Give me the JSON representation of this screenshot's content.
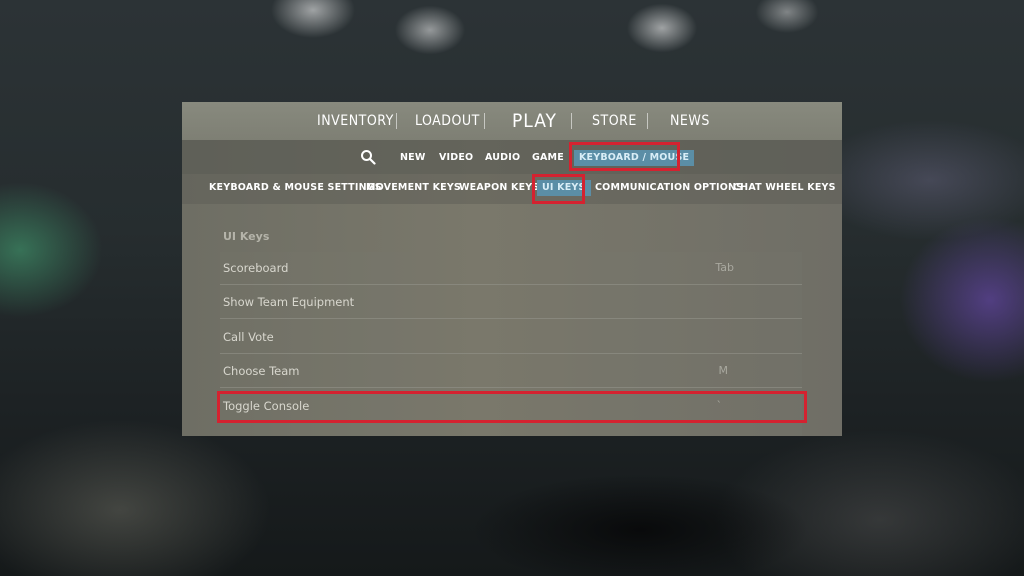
{
  "topnav": {
    "inventory": "INVENTORY",
    "loadout": "LOADOUT",
    "play": "PLAY",
    "store": "STORE",
    "news": "NEWS"
  },
  "settings_tabs": {
    "new": "NEW",
    "video": "VIDEO",
    "audio": "AUDIO",
    "game": "GAME",
    "keyboard_mouse": "KEYBOARD / MOUSE"
  },
  "categories": {
    "keyboard_mouse_settings": "KEYBOARD & MOUSE SETTINGS",
    "movement_keys": "MOVEMENT KEYS",
    "weapon_keys": "WEAPON KEYS",
    "ui_keys": "UI KEYS",
    "communication_options": "COMMUNICATION OPTIONS",
    "chat_wheel_keys": "CHAT WHEEL KEYS"
  },
  "section": {
    "title": "UI Keys",
    "rows": [
      {
        "label": "Scoreboard",
        "key": "Tab"
      },
      {
        "label": "Show Team Equipment",
        "key": ""
      },
      {
        "label": "Call Vote",
        "key": ""
      },
      {
        "label": "Choose Team",
        "key": "M"
      },
      {
        "label": "Toggle Console",
        "key": "`"
      }
    ]
  },
  "colors": {
    "active_tab": "#5b8ea6",
    "highlight": "#d42230"
  },
  "icons": {
    "search": "search-icon"
  }
}
